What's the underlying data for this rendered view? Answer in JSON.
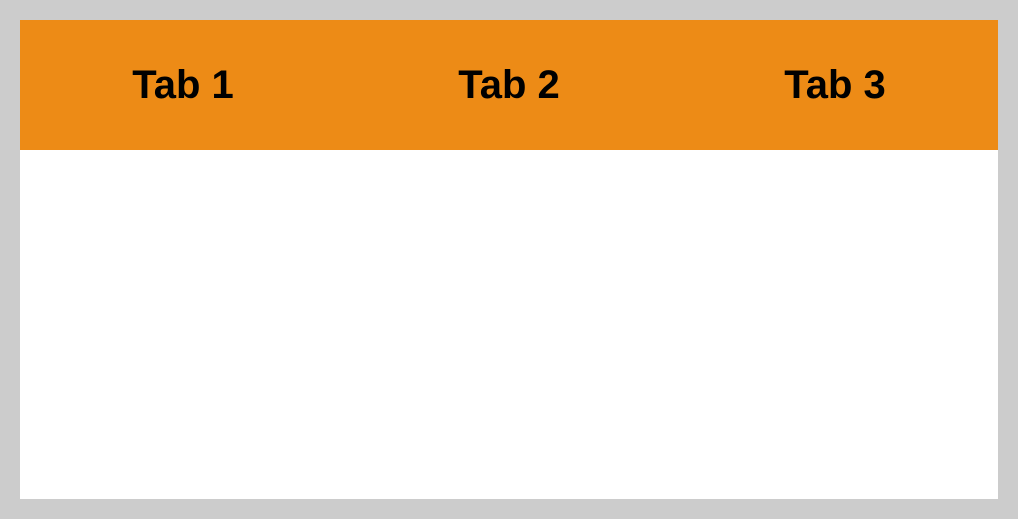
{
  "tabs": [
    {
      "label": "Tab 1"
    },
    {
      "label": "Tab 2"
    },
    {
      "label": "Tab 3"
    }
  ]
}
